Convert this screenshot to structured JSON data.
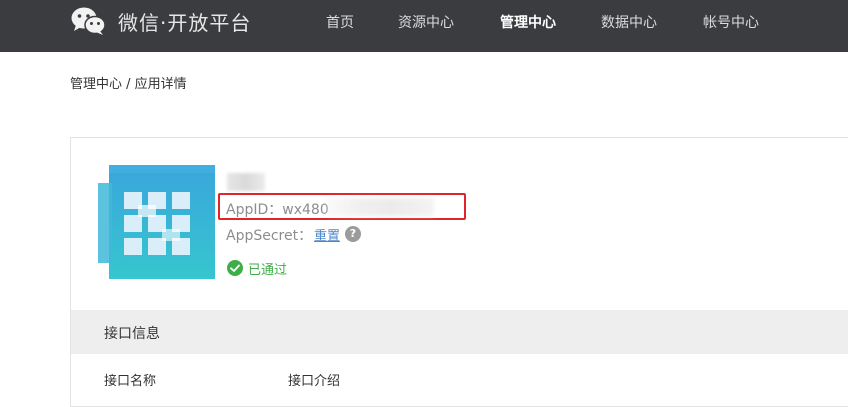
{
  "header": {
    "brand": "微信·开放平台",
    "nav": [
      {
        "label": "首页",
        "active": false
      },
      {
        "label": "资源中心",
        "active": false
      },
      {
        "label": "管理中心",
        "active": true
      },
      {
        "label": "数据中心",
        "active": false
      },
      {
        "label": "帐号中心",
        "active": false
      }
    ]
  },
  "breadcrumb": "管理中心 / 应用详情",
  "app": {
    "appid_label": "AppID：",
    "appid_value": "wx480",
    "appsecret_label": "AppSecret：",
    "reset_link": "重置",
    "help_icon": "?",
    "status": "已通过"
  },
  "section": {
    "title": "接口信息",
    "columns": [
      "接口名称",
      "接口介绍"
    ]
  },
  "colors": {
    "topbar": "#3b3c40",
    "highlight_border": "#e0242a",
    "link": "#4c87c7",
    "success": "#3fae49"
  }
}
